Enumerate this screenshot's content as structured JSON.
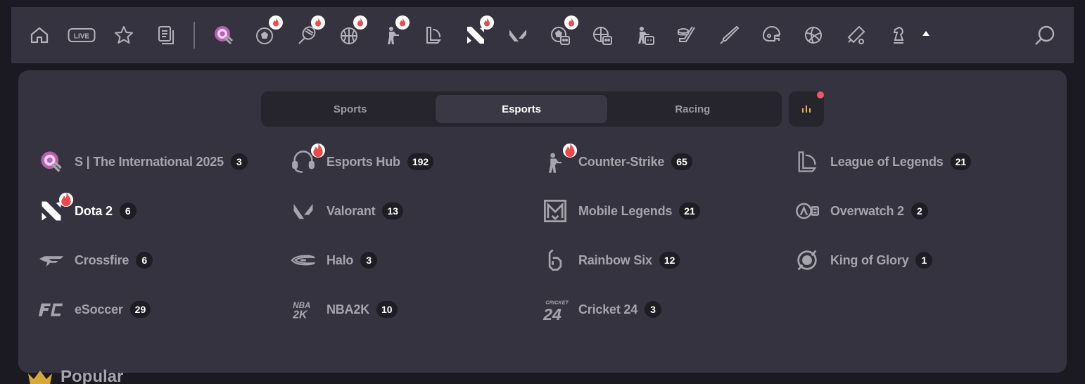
{
  "colors": {
    "accent_red": "#f0576a",
    "fire": "#ec4a4a",
    "gold": "#e4b73a",
    "panel": "#34333f",
    "dark": "#26252e"
  },
  "topbar": {
    "icons": [
      {
        "name": "home-icon"
      },
      {
        "name": "live-icon",
        "text": "LIVE"
      },
      {
        "name": "favorites-star-icon"
      },
      {
        "name": "betslip-icon"
      },
      {
        "name": "the-international-icon"
      },
      {
        "name": "soccer-icon",
        "hot": true
      },
      {
        "name": "tennis-icon",
        "hot": true
      },
      {
        "name": "basketball-icon",
        "hot": true
      },
      {
        "name": "counter-strike-icon",
        "hot": true
      },
      {
        "name": "league-of-legends-icon"
      },
      {
        "name": "dota-2-icon",
        "hot": true
      },
      {
        "name": "valorant-icon"
      },
      {
        "name": "esoccer-bot-icon",
        "hot": true
      },
      {
        "name": "ebasketball-bot-icon"
      },
      {
        "name": "ecs-bot-icon"
      },
      {
        "name": "ice-hockey-icon"
      },
      {
        "name": "baseball-icon"
      },
      {
        "name": "american-football-icon"
      },
      {
        "name": "volleyball-icon"
      },
      {
        "name": "cricket-icon"
      },
      {
        "name": "chess-icon"
      }
    ]
  },
  "tabs": [
    {
      "label": "Sports",
      "active": false
    },
    {
      "label": "Esports",
      "active": true
    },
    {
      "label": "Racing",
      "active": false
    }
  ],
  "items": [
    {
      "label": "S | The International 2025",
      "count": "3",
      "icon": "the-international-icon"
    },
    {
      "label": "Esports Hub",
      "count": "192",
      "icon": "esports-hub-icon",
      "hot": true
    },
    {
      "label": "Counter-Strike",
      "count": "65",
      "icon": "counter-strike-icon",
      "hot": true
    },
    {
      "label": "League of Legends",
      "count": "21",
      "icon": "league-of-legends-icon"
    },
    {
      "label": "Dota 2",
      "count": "6",
      "icon": "dota-2-icon",
      "hot": true,
      "active": true
    },
    {
      "label": "Valorant",
      "count": "13",
      "icon": "valorant-icon"
    },
    {
      "label": "Mobile Legends",
      "count": "21",
      "icon": "mobile-legends-icon"
    },
    {
      "label": "Overwatch 2",
      "count": "2",
      "icon": "overwatch-icon"
    },
    {
      "label": "Crossfire",
      "count": "6",
      "icon": "crossfire-icon"
    },
    {
      "label": "Halo",
      "count": "3",
      "icon": "halo-icon"
    },
    {
      "label": "Rainbow Six",
      "count": "12",
      "icon": "rainbow-six-icon"
    },
    {
      "label": "King of Glory",
      "count": "1",
      "icon": "king-of-glory-icon"
    },
    {
      "label": "eSoccer",
      "count": "29",
      "icon": "fc-icon"
    },
    {
      "label": "NBA2K",
      "count": "10",
      "icon": "nba2k-icon"
    },
    {
      "label": "Cricket 24",
      "count": "3",
      "icon": "cricket-24-icon"
    }
  ],
  "popular": {
    "label": "Popular"
  }
}
